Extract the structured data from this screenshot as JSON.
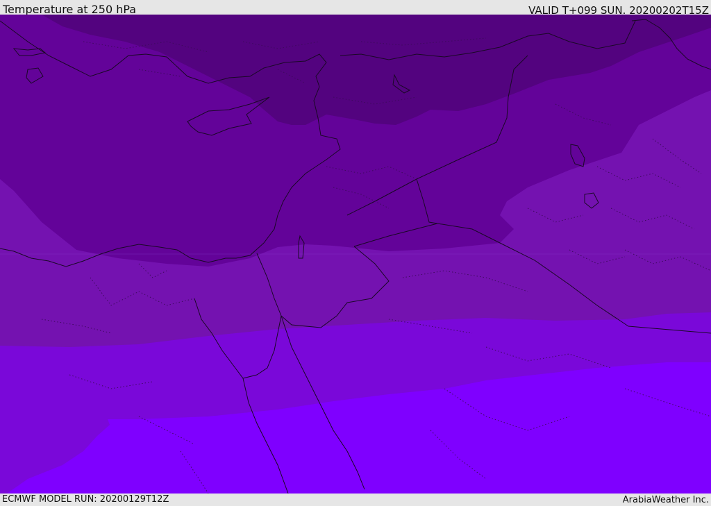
{
  "header": {
    "title": "Temperature at 250 hPa",
    "valid_time": "VALID T+099 SUN. 20200202T15Z"
  },
  "footer": {
    "model_run": "ECMWF MODEL RUN: 20200129T12Z",
    "provider": "ArabiaWeather Inc."
  },
  "colors": {
    "band_coldest": "#53037f",
    "band_cold": "#630399",
    "band_mid": "#7412b0",
    "band_warm": "#7a08d9",
    "band_warmest": "#7f00ff",
    "coastline": "#1a0826",
    "border_dotted": "#3d0a5c"
  }
}
